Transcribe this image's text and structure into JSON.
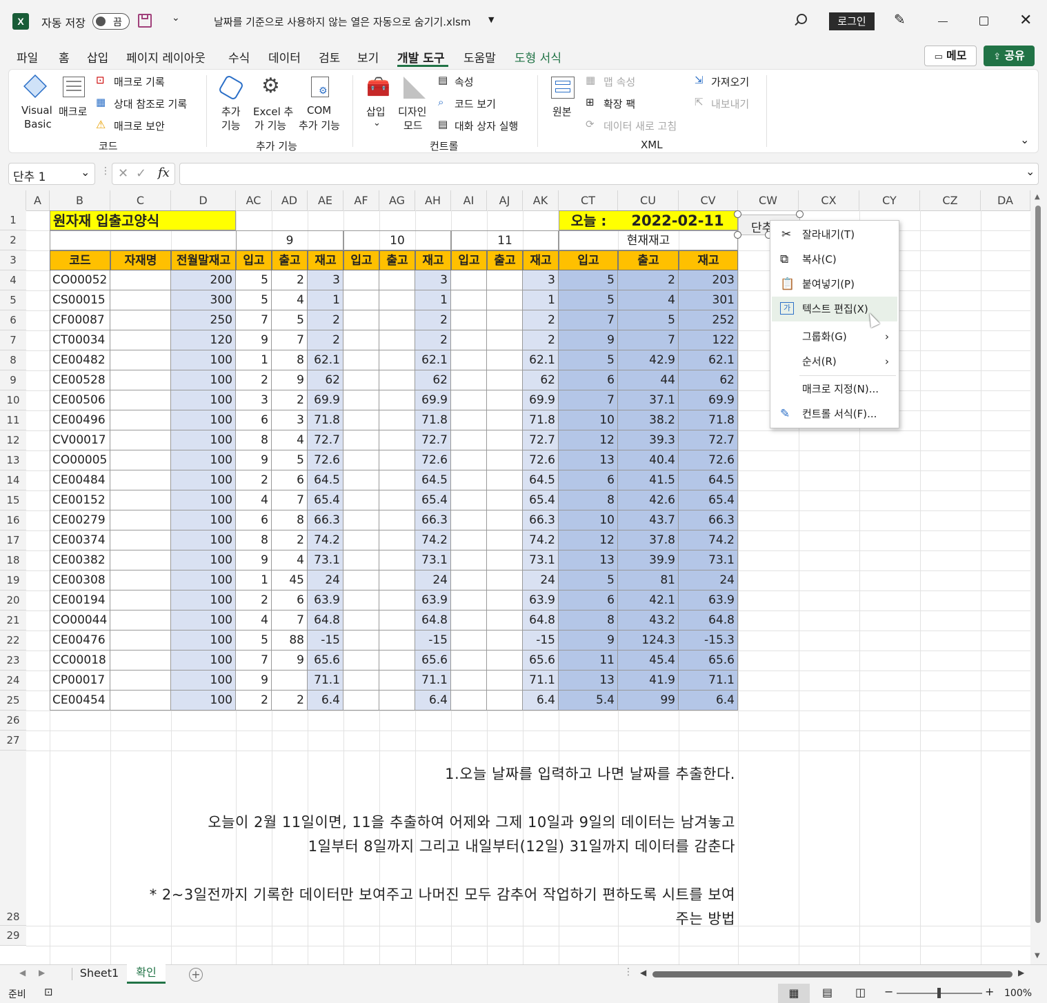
{
  "titlebar": {
    "autosave_label": "자동 저장",
    "toggle_label": "끔",
    "doc_title": "날짜를 기준으로 사용하지 않는 열은 자동으로 숨기기.xlsm",
    "login": "로그인"
  },
  "menu": {
    "tabs": [
      "파일",
      "홈",
      "삽입",
      "페이지 레이아웃",
      "수식",
      "데이터",
      "검토",
      "보기",
      "개발 도구",
      "도움말",
      "도형 서식"
    ],
    "memo": "메모",
    "share": "공유"
  },
  "ribbon": {
    "code": {
      "vb1": "Visual",
      "vb2": "Basic",
      "macro": "매크로",
      "record": "매크로 기록",
      "relative": "상대 참조로 기록",
      "security": "매크로 보안",
      "label": "코드"
    },
    "addins": {
      "add1": "추가",
      "add2": "기능",
      "excel1": "Excel 추",
      "excel2": "가 기능",
      "com1": "COM",
      "com2": "추가 기능",
      "label": "추가 기능"
    },
    "controls": {
      "insert": "삽입",
      "design1": "디자인",
      "design2": "모드",
      "props": "속성",
      "viewcode": "코드 보기",
      "dialog": "대화 상자 실행",
      "label": "컨트롤"
    },
    "xml": {
      "source": "원본",
      "map": "맵 속성",
      "pack": "확장 팩",
      "refresh": "데이터 새로 고침",
      "import": "가져오기",
      "export": "내보내기",
      "label": "XML"
    }
  },
  "formula": {
    "namebox": "단추 1",
    "fx": "fx",
    "value": ""
  },
  "columns": [
    "A",
    "B",
    "C",
    "D",
    "AC",
    "AD",
    "AE",
    "AF",
    "AG",
    "AH",
    "AI",
    "AJ",
    "AK",
    "CT",
    "CU",
    "CV",
    "CW",
    "CX",
    "CY",
    "CZ",
    "DA"
  ],
  "sheet": {
    "title": "원자재 입출고양식",
    "today_label": "오늘 :",
    "today_value": "2022-02-11",
    "button_label": "단추 1",
    "groups": [
      "9",
      "10",
      "11",
      "현재재고"
    ],
    "headers": [
      "코드",
      "자재명",
      "전월말재고",
      "입고",
      "출고",
      "재고",
      "입고",
      "출고",
      "재고",
      "입고",
      "출고",
      "재고",
      "입고",
      "출고",
      "재고"
    ],
    "rows": [
      [
        "CO00052",
        "",
        "200",
        "5",
        "2",
        "3",
        "",
        "",
        "3",
        "",
        "",
        "3",
        "5",
        "2",
        "203"
      ],
      [
        "CS00015",
        "",
        "300",
        "5",
        "4",
        "1",
        "",
        "",
        "1",
        "",
        "",
        "1",
        "5",
        "4",
        "301"
      ],
      [
        "CF00087",
        "",
        "250",
        "7",
        "5",
        "2",
        "",
        "",
        "2",
        "",
        "",
        "2",
        "7",
        "5",
        "252"
      ],
      [
        "CT00034",
        "",
        "120",
        "9",
        "7",
        "2",
        "",
        "",
        "2",
        "",
        "",
        "2",
        "9",
        "7",
        "122"
      ],
      [
        "CE00482",
        "",
        "100",
        "1",
        "8",
        "62.1",
        "",
        "",
        "62.1",
        "",
        "",
        "62.1",
        "5",
        "42.9",
        "62.1"
      ],
      [
        "CE00528",
        "",
        "100",
        "2",
        "9",
        "62",
        "",
        "",
        "62",
        "",
        "",
        "62",
        "6",
        "44",
        "62"
      ],
      [
        "CE00506",
        "",
        "100",
        "3",
        "2",
        "69.9",
        "",
        "",
        "69.9",
        "",
        "",
        "69.9",
        "7",
        "37.1",
        "69.9"
      ],
      [
        "CE00496",
        "",
        "100",
        "6",
        "3",
        "71.8",
        "",
        "",
        "71.8",
        "",
        "",
        "71.8",
        "10",
        "38.2",
        "71.8"
      ],
      [
        "CV00017",
        "",
        "100",
        "8",
        "4",
        "72.7",
        "",
        "",
        "72.7",
        "",
        "",
        "72.7",
        "12",
        "39.3",
        "72.7"
      ],
      [
        "CO00005",
        "",
        "100",
        "9",
        "5",
        "72.6",
        "",
        "",
        "72.6",
        "",
        "",
        "72.6",
        "13",
        "40.4",
        "72.6"
      ],
      [
        "CE00484",
        "",
        "100",
        "2",
        "6",
        "64.5",
        "",
        "",
        "64.5",
        "",
        "",
        "64.5",
        "6",
        "41.5",
        "64.5"
      ],
      [
        "CE00152",
        "",
        "100",
        "4",
        "7",
        "65.4",
        "",
        "",
        "65.4",
        "",
        "",
        "65.4",
        "8",
        "42.6",
        "65.4"
      ],
      [
        "CE00279",
        "",
        "100",
        "6",
        "8",
        "66.3",
        "",
        "",
        "66.3",
        "",
        "",
        "66.3",
        "10",
        "43.7",
        "66.3"
      ],
      [
        "CE00374",
        "",
        "100",
        "8",
        "2",
        "74.2",
        "",
        "",
        "74.2",
        "",
        "",
        "74.2",
        "12",
        "37.8",
        "74.2"
      ],
      [
        "CE00382",
        "",
        "100",
        "9",
        "4",
        "73.1",
        "",
        "",
        "73.1",
        "",
        "",
        "73.1",
        "13",
        "39.9",
        "73.1"
      ],
      [
        "CE00308",
        "",
        "100",
        "1",
        "45",
        "24",
        "",
        "",
        "24",
        "",
        "",
        "24",
        "5",
        "81",
        "24"
      ],
      [
        "CE00194",
        "",
        "100",
        "2",
        "6",
        "63.9",
        "",
        "",
        "63.9",
        "",
        "",
        "63.9",
        "6",
        "42.1",
        "63.9"
      ],
      [
        "CO00044",
        "",
        "100",
        "4",
        "7",
        "64.8",
        "",
        "",
        "64.8",
        "",
        "",
        "64.8",
        "8",
        "43.2",
        "64.8"
      ],
      [
        "CE00476",
        "",
        "100",
        "5",
        "88",
        "-15",
        "",
        "",
        "-15",
        "",
        "",
        "-15",
        "9",
        "124.3",
        "-15.3"
      ],
      [
        "CC00018",
        "",
        "100",
        "7",
        "9",
        "65.6",
        "",
        "",
        "65.6",
        "",
        "",
        "65.6",
        "11",
        "45.4",
        "65.6"
      ],
      [
        "CP00017",
        "",
        "100",
        "9",
        "",
        "71.1",
        "",
        "",
        "71.1",
        "",
        "",
        "71.1",
        "13",
        "41.9",
        "71.1"
      ],
      [
        "CE00454",
        "",
        "100",
        "2",
        "2",
        "6.4",
        "",
        "",
        "6.4",
        "",
        "",
        "6.4",
        "5.4",
        "99",
        "6.4"
      ]
    ],
    "notes": [
      "1.오늘 날짜를 입력하고 나면 날짜를 추출한다.",
      "오늘이 2월 11일이면,  11을 추출하여 어제와 그제 10일과 9일의 데이터는 남겨놓고",
      "1일부터 8일까지 그리고 내일부터(12일) 31일까지 데이터를 감춘다",
      "* 2~3일전까지 기록한 데이터만 보여주고 나머진 모두 감추어 작업하기 편하도록 시트를 보여",
      "주는 방법"
    ]
  },
  "context_menu": [
    "잘라내기(T)",
    "복사(C)",
    "붙여넣기(P)",
    "텍스트 편집(X)",
    "그룹화(G)",
    "순서(R)",
    "매크로 지정(N)...",
    "컨트롤 서식(F)..."
  ],
  "sheet_tabs": [
    "Sheet1",
    "확인"
  ],
  "status": {
    "ready": "준비",
    "zoom": "100%"
  },
  "colors": {
    "excel_green": "#217346",
    "yellow": "#ffff00",
    "orange": "#ffc000",
    "light_blue": "#d9e1f2",
    "mid_blue": "#b4c6e7"
  }
}
